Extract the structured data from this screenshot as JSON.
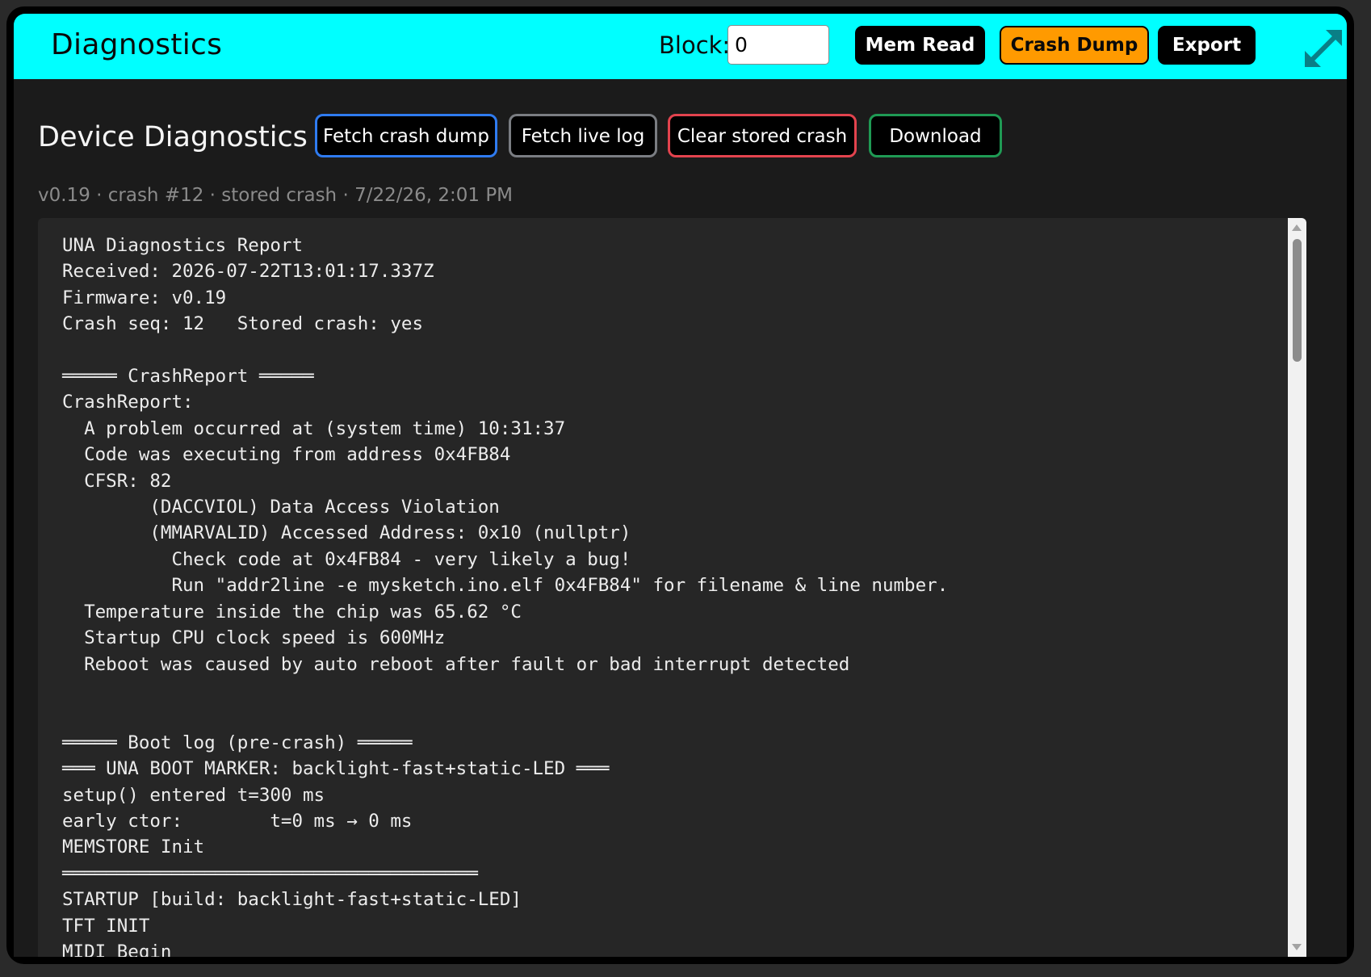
{
  "topbar": {
    "title": "Diagnostics",
    "block_label": "Block:",
    "block_value": "0",
    "mem_read_label": "Mem Read",
    "crash_dump_label": "Crash Dump",
    "export_label": "Export",
    "accent_color": "#00ffff",
    "active_button_color": "#ff9a00"
  },
  "main": {
    "title": "Device Diagnostics",
    "actions": {
      "fetch_crash_dump": "Fetch crash dump",
      "fetch_live_log": "Fetch live log",
      "clear_stored_crash": "Clear stored crash",
      "download": "Download"
    },
    "action_border_colors": {
      "fetch_crash_dump": "#2f7bf0",
      "fetch_live_log": "#7a7d82",
      "clear_stored_crash": "#e3434e",
      "download": "#1f9a54"
    },
    "meta": "v0.19 · crash #12 · stored crash · 7/22/26, 2:01 PM"
  },
  "log": {
    "text": "UNA Diagnostics Report\nReceived: 2026-07-22T13:01:17.337Z\nFirmware: v0.19\nCrash seq: 12   Stored crash: yes\n\n═════ CrashReport ═════\nCrashReport:\n  A problem occurred at (system time) 10:31:37\n  Code was executing from address 0x4FB84\n  CFSR: 82\n        (DACCVIOL) Data Access Violation\n        (MMARVALID) Accessed Address: 0x10 (nullptr)\n          Check code at 0x4FB84 - very likely a bug!\n          Run \"addr2line -e mysketch.ino.elf 0x4FB84\" for filename & line number.\n  Temperature inside the chip was 65.62 °C\n  Startup CPU clock speed is 600MHz\n  Reboot was caused by auto reboot after fault or bad interrupt detected\n\n\n═════ Boot log (pre-crash) ═════\n═══ UNA BOOT MARKER: backlight-fast+static-LED ═══\nsetup() entered t=300 ms\nearly ctor:        t=0 ms → 0 ms\nMEMSTORE Init\n══════════════════════════════════════\nSTARTUP [build: backlight-fast+static-LED]\nTFT INIT\nMIDI Begin"
  },
  "icons": {
    "expand": "expand-diagonal-arrows-icon",
    "scroll_up": "scroll-up-arrow-icon",
    "scroll_down": "scroll-down-arrow-icon"
  }
}
